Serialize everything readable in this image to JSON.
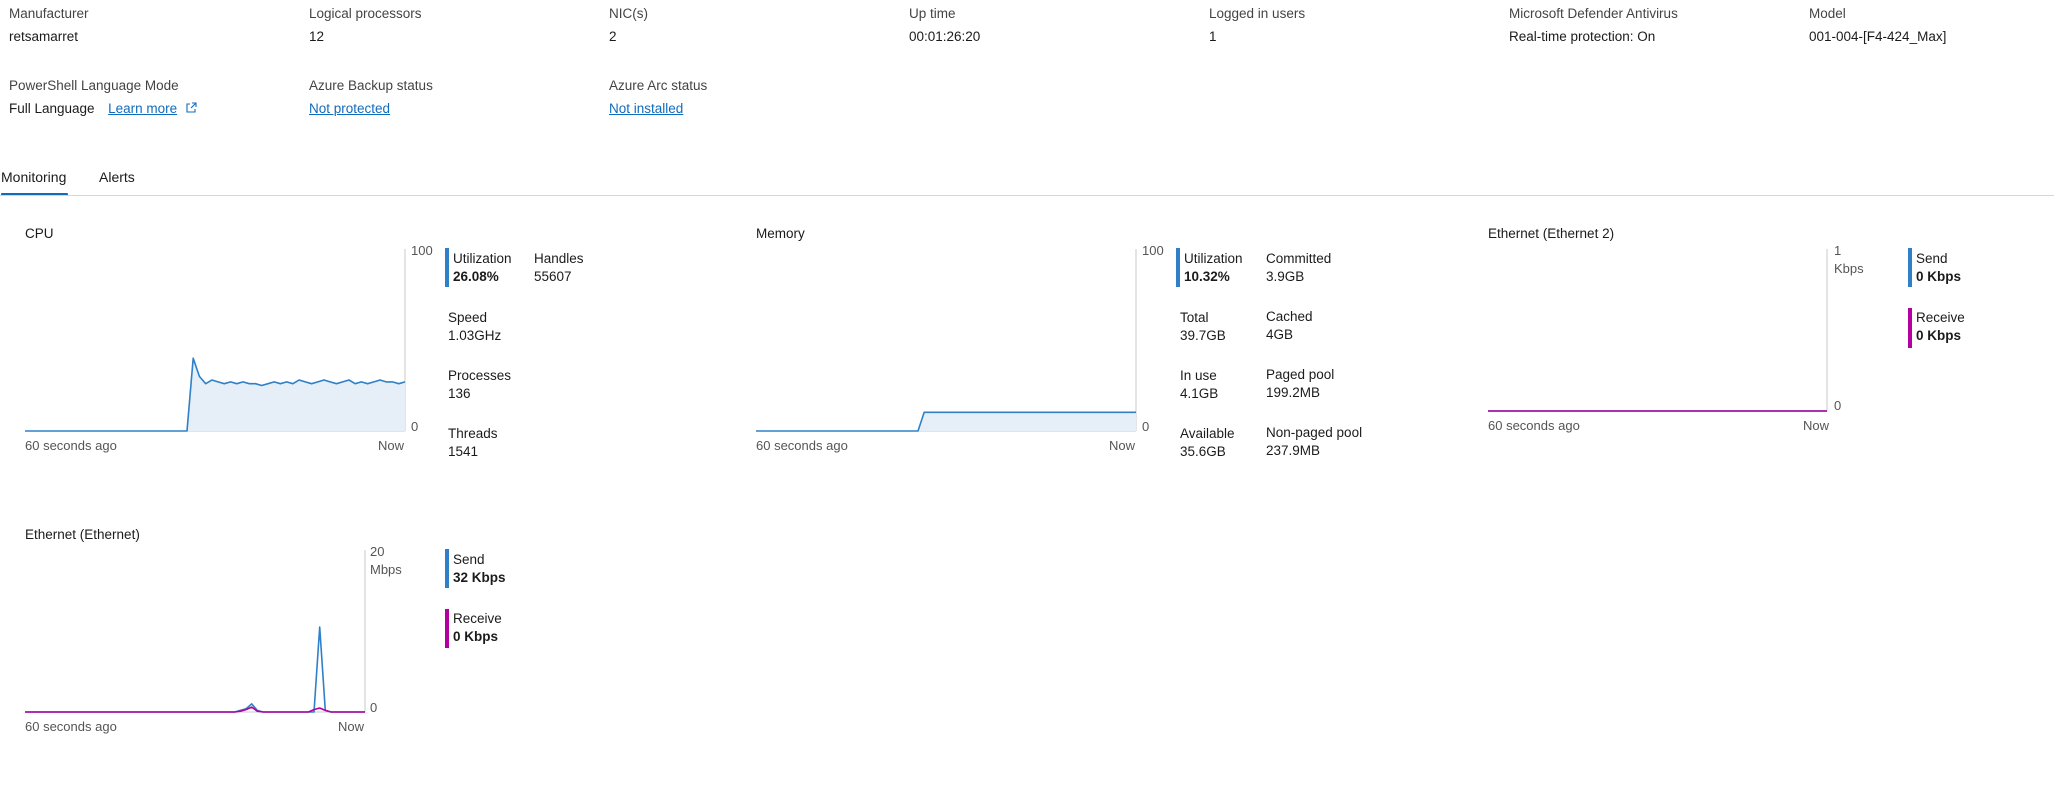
{
  "properties": {
    "manufacturer": {
      "label": "Manufacturer",
      "value": "retsamarret"
    },
    "logical_processors": {
      "label": "Logical processors",
      "value": "12"
    },
    "nics": {
      "label": "NIC(s)",
      "value": "2"
    },
    "uptime": {
      "label": "Up time",
      "value": "00:01:26:20"
    },
    "logged_in_users": {
      "label": "Logged in users",
      "value": "1"
    },
    "defender": {
      "label": "Microsoft Defender Antivirus",
      "value": "Real-time protection: On"
    },
    "model": {
      "label": "Model",
      "value": "001-004-[F4-424_Max]"
    },
    "ps_language_mode": {
      "label": "PowerShell Language Mode",
      "value": "Full Language",
      "link": "Learn more"
    },
    "azure_backup": {
      "label": "Azure Backup status",
      "value": "Not protected"
    },
    "azure_arc": {
      "label": "Azure Arc status",
      "value": "Not installed"
    }
  },
  "tabs": [
    {
      "label": "Monitoring",
      "selected": true
    },
    {
      "label": "Alerts",
      "selected": false
    }
  ],
  "colors": {
    "accent": "#0f6cbd",
    "series_blue": "#2f80c8",
    "series_magenta": "#b4009e",
    "fill": "#e6eff8"
  },
  "cpu": {
    "title": "CPU",
    "y_max": "100",
    "y_min": "0",
    "x_start": "60 seconds ago",
    "x_end": "Now",
    "utilization_label": "Utilization",
    "utilization_value": "26.08%",
    "handles_label": "Handles",
    "handles_value": "55607",
    "speed_label": "Speed",
    "speed_value": "1.03GHz",
    "processes_label": "Processes",
    "processes_value": "136",
    "threads_label": "Threads",
    "threads_value": "1541"
  },
  "memory": {
    "title": "Memory",
    "y_max": "100",
    "y_min": "0",
    "x_start": "60 seconds ago",
    "x_end": "Now",
    "utilization_label": "Utilization",
    "utilization_value": "10.32%",
    "committed_label": "Committed",
    "committed_value": "3.9GB",
    "total_label": "Total",
    "total_value": "39.7GB",
    "cached_label": "Cached",
    "cached_value": "4GB",
    "inuse_label": "In use",
    "inuse_value": "4.1GB",
    "paged_label": "Paged pool",
    "paged_value": "199.2MB",
    "available_label": "Available",
    "available_value": "35.6GB",
    "nonpaged_label": "Non-paged pool",
    "nonpaged_value": "237.9MB"
  },
  "eth2": {
    "title": "Ethernet (Ethernet 2)",
    "y_max": "1",
    "y_unit": "Kbps",
    "y_min": "0",
    "x_start": "60 seconds ago",
    "x_end": "Now",
    "send_label": "Send",
    "send_value": "0 Kbps",
    "receive_label": "Receive",
    "receive_value": "0 Kbps"
  },
  "eth": {
    "title": "Ethernet (Ethernet)",
    "y_max": "20",
    "y_unit": "Mbps",
    "y_min": "0",
    "x_start": "60 seconds ago",
    "x_end": "Now",
    "send_label": "Send",
    "send_value": "32 Kbps",
    "receive_label": "Receive",
    "receive_value": "0 Kbps"
  },
  "chart_data": [
    {
      "type": "area",
      "title": "CPU",
      "ylim": [
        0,
        100
      ],
      "x_labels": [
        "60 seconds ago",
        "Now"
      ],
      "series": [
        {
          "values": [
            0,
            0,
            0,
            0,
            0,
            0,
            0,
            0,
            0,
            0,
            0,
            0,
            0,
            0,
            0,
            0,
            0,
            0,
            0,
            0,
            0,
            0,
            0,
            0,
            0,
            0,
            0,
            40,
            30,
            26,
            28,
            27,
            26,
            27,
            26,
            27,
            26,
            26,
            25,
            26,
            27,
            26,
            27,
            26,
            28,
            27,
            26,
            27,
            28,
            27,
            26,
            27,
            28,
            26,
            27,
            26,
            27,
            28,
            27,
            27,
            26,
            27
          ]
        }
      ]
    },
    {
      "type": "area",
      "title": "Memory",
      "ylim": [
        0,
        100
      ],
      "x_labels": [
        "60 seconds ago",
        "Now"
      ],
      "series": [
        {
          "values": [
            0,
            0,
            0,
            0,
            0,
            0,
            0,
            0,
            0,
            0,
            0,
            0,
            0,
            0,
            0,
            0,
            0,
            0,
            0,
            0,
            0,
            0,
            0,
            0,
            0,
            0,
            0,
            10.3,
            10.3,
            10.3,
            10.3,
            10.3,
            10.3,
            10.3,
            10.3,
            10.3,
            10.3,
            10.3,
            10.3,
            10.3,
            10.3,
            10.3,
            10.3,
            10.3,
            10.3,
            10.3,
            10.3,
            10.3,
            10.3,
            10.3,
            10.3,
            10.3,
            10.3,
            10.3,
            10.3,
            10.3,
            10.3,
            10.3,
            10.3,
            10.3,
            10.3,
            10.3
          ]
        }
      ]
    },
    {
      "type": "line",
      "title": "Ethernet (Ethernet 2)",
      "ylim": [
        0,
        1
      ],
      "x_labels": [
        "60 seconds ago",
        "Now"
      ],
      "series": [
        {
          "name": "Send",
          "values": [
            0,
            0,
            0,
            0,
            0,
            0,
            0,
            0,
            0,
            0,
            0,
            0,
            0,
            0,
            0,
            0,
            0,
            0,
            0,
            0,
            0,
            0,
            0,
            0,
            0,
            0,
            0,
            0,
            0,
            0,
            0,
            0,
            0,
            0,
            0,
            0,
            0,
            0,
            0,
            0,
            0,
            0,
            0,
            0,
            0,
            0,
            0,
            0,
            0,
            0,
            0,
            0,
            0,
            0,
            0,
            0,
            0,
            0,
            0,
            0,
            0
          ]
        },
        {
          "name": "Receive",
          "values": [
            0,
            0,
            0,
            0,
            0,
            0,
            0,
            0,
            0,
            0,
            0,
            0,
            0,
            0,
            0,
            0,
            0,
            0,
            0,
            0,
            0,
            0,
            0,
            0,
            0,
            0,
            0,
            0,
            0,
            0,
            0,
            0,
            0,
            0,
            0,
            0,
            0,
            0,
            0,
            0,
            0,
            0,
            0,
            0,
            0,
            0,
            0,
            0,
            0,
            0,
            0,
            0,
            0,
            0,
            0,
            0,
            0,
            0,
            0,
            0,
            0
          ]
        }
      ]
    },
    {
      "type": "line",
      "title": "Ethernet (Ethernet)",
      "ylim": [
        0,
        20
      ],
      "y_unit": "Mbps",
      "x_labels": [
        "60 seconds ago",
        "Now"
      ],
      "series": [
        {
          "name": "Send",
          "values": [
            0,
            0,
            0,
            0,
            0,
            0,
            0,
            0,
            0,
            0,
            0,
            0,
            0,
            0,
            0,
            0,
            0,
            0,
            0,
            0,
            0,
            0,
            0,
            0,
            0,
            0,
            0,
            0,
            0,
            0,
            0,
            0,
            0,
            0,
            0,
            0,
            0,
            0,
            0.2,
            0.4,
            1.0,
            0.2,
            0,
            0,
            0,
            0,
            0,
            0,
            0,
            0,
            0,
            0,
            10.5,
            0.2,
            0,
            0,
            0,
            0,
            0,
            0,
            0
          ]
        },
        {
          "name": "Receive",
          "values": [
            0,
            0,
            0,
            0,
            0,
            0,
            0,
            0,
            0,
            0,
            0,
            0,
            0,
            0,
            0,
            0,
            0,
            0,
            0,
            0,
            0,
            0,
            0,
            0,
            0,
            0,
            0,
            0,
            0,
            0,
            0,
            0,
            0,
            0,
            0,
            0,
            0,
            0,
            0.1,
            0.3,
            0.6,
            0.1,
            0,
            0,
            0,
            0,
            0,
            0,
            0,
            0,
            0,
            0.3,
            0.5,
            0.2,
            0,
            0,
            0,
            0,
            0,
            0,
            0
          ]
        }
      ]
    }
  ]
}
